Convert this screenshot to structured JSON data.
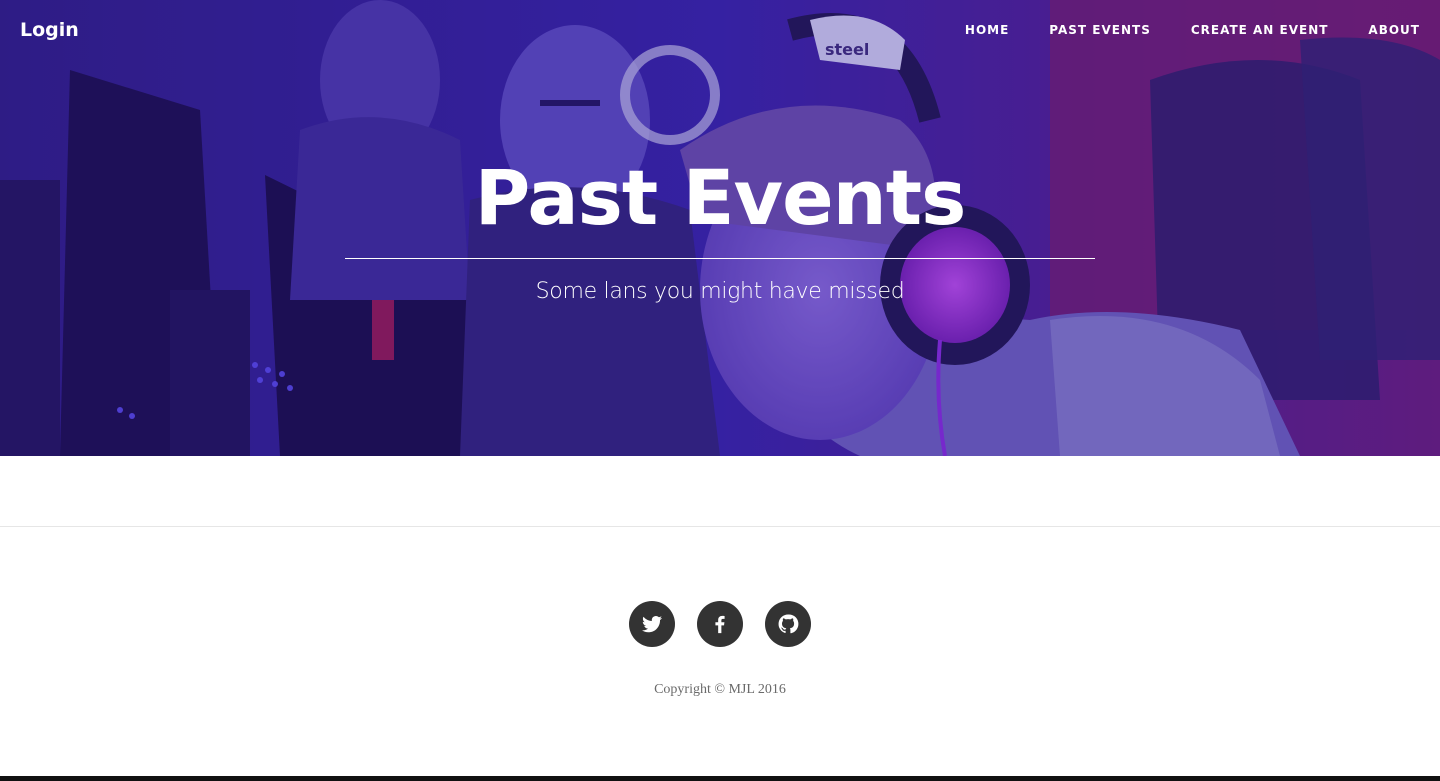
{
  "nav": {
    "brand": "Login",
    "links": [
      {
        "label": "Home"
      },
      {
        "label": "Past Events"
      },
      {
        "label": "Create an Event"
      },
      {
        "label": "About"
      }
    ]
  },
  "hero": {
    "title": "Past Events",
    "subtitle": "Some lans you might have missed",
    "headset_brand": "steel"
  },
  "footer": {
    "social": [
      {
        "name": "twitter",
        "icon": "twitter-icon"
      },
      {
        "name": "facebook",
        "icon": "facebook-icon"
      },
      {
        "name": "github",
        "icon": "github-icon"
      }
    ],
    "copyright": "Copyright © MJL 2016"
  },
  "colors": {
    "hero_tint": "#3b22a8",
    "footer_icon_bg": "#333333",
    "copyright_text": "#6a6a6a"
  }
}
